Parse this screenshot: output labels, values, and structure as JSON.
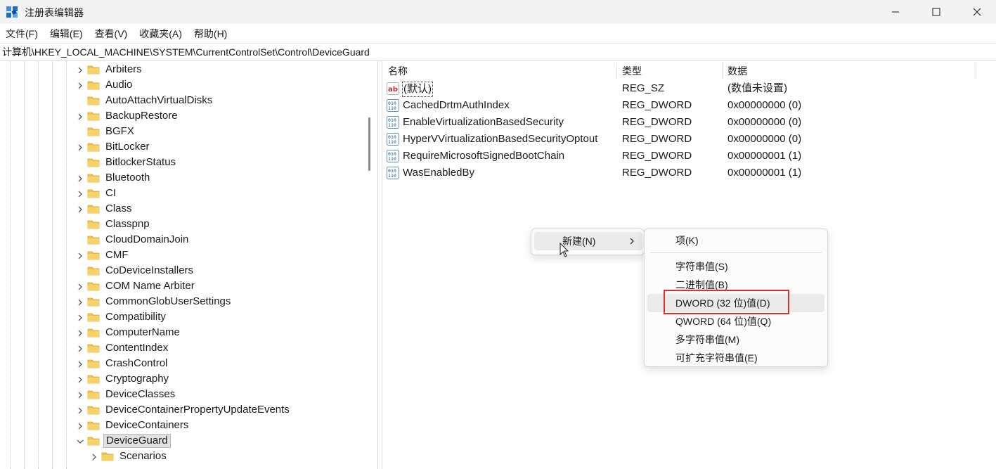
{
  "window": {
    "title": "注册表编辑器",
    "accent": "#0067c0"
  },
  "menubar": {
    "items": [
      "文件(F)",
      "编辑(E)",
      "查看(V)",
      "收藏夹(A)",
      "帮助(H)"
    ]
  },
  "address": {
    "path": "计算机\\HKEY_LOCAL_MACHINE\\SYSTEM\\CurrentControlSet\\Control\\DeviceGuard"
  },
  "tree": {
    "items": [
      {
        "label": "Arbiters",
        "expandable": true
      },
      {
        "label": "Audio",
        "expandable": true
      },
      {
        "label": "AutoAttachVirtualDisks",
        "expandable": false
      },
      {
        "label": "BackupRestore",
        "expandable": true
      },
      {
        "label": "BGFX",
        "expandable": false
      },
      {
        "label": "BitLocker",
        "expandable": true
      },
      {
        "label": "BitlockerStatus",
        "expandable": false
      },
      {
        "label": "Bluetooth",
        "expandable": true
      },
      {
        "label": "CI",
        "expandable": true
      },
      {
        "label": "Class",
        "expandable": true
      },
      {
        "label": "Classpnp",
        "expandable": false
      },
      {
        "label": "CloudDomainJoin",
        "expandable": false
      },
      {
        "label": "CMF",
        "expandable": true
      },
      {
        "label": "CoDeviceInstallers",
        "expandable": false
      },
      {
        "label": "COM Name Arbiter",
        "expandable": true
      },
      {
        "label": "CommonGlobUserSettings",
        "expandable": true
      },
      {
        "label": "Compatibility",
        "expandable": true
      },
      {
        "label": "ComputerName",
        "expandable": true
      },
      {
        "label": "ContentIndex",
        "expandable": true
      },
      {
        "label": "CrashControl",
        "expandable": true
      },
      {
        "label": "Cryptography",
        "expandable": true
      },
      {
        "label": "DeviceClasses",
        "expandable": true
      },
      {
        "label": "DeviceContainerPropertyUpdateEvents",
        "expandable": true
      },
      {
        "label": "DeviceContainers",
        "expandable": true
      },
      {
        "label": "DeviceGuard",
        "expandable": true,
        "expanded": true,
        "selected": true
      },
      {
        "label": "Scenarios",
        "expandable": true,
        "child": true
      }
    ]
  },
  "values": {
    "columns": {
      "name": "名称",
      "type": "类型",
      "data": "数据"
    },
    "rows": [
      {
        "name": "(默认)",
        "type": "REG_SZ",
        "data": "(数值未设置)",
        "icon": "string-value-icon"
      },
      {
        "name": "CachedDrtmAuthIndex",
        "type": "REG_DWORD",
        "data": "0x00000000 (0)",
        "icon": "binary-value-icon"
      },
      {
        "name": "EnableVirtualizationBasedSecurity",
        "type": "REG_DWORD",
        "data": "0x00000000 (0)",
        "icon": "binary-value-icon"
      },
      {
        "name": "HyperVVirtualizationBasedSecurityOptout",
        "type": "REG_DWORD",
        "data": "0x00000000 (0)",
        "icon": "binary-value-icon"
      },
      {
        "name": "RequireMicrosoftSignedBootChain",
        "type": "REG_DWORD",
        "data": "0x00000001 (1)",
        "icon": "binary-value-icon"
      },
      {
        "name": "WasEnabledBy",
        "type": "REG_DWORD",
        "data": "0x00000001 (1)",
        "icon": "binary-value-icon"
      }
    ]
  },
  "context_menu": {
    "new_label": "新建(N)"
  },
  "submenu": {
    "key": "项(K)",
    "items": [
      "字符串值(S)",
      "二进制值(B)",
      "DWORD (32 位)值(D)",
      "QWORD (64 位)值(Q)",
      "多字符串值(M)",
      "可扩充字符串值(E)"
    ],
    "highlight_color": "#d9302c"
  }
}
